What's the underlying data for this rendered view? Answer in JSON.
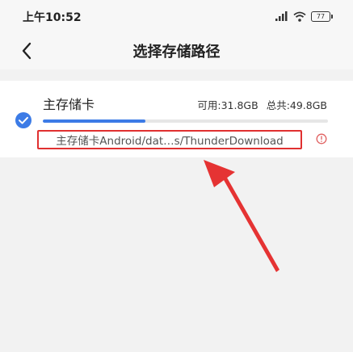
{
  "status_bar": {
    "time": "上午10:52",
    "icons": [
      "signal-icon",
      "wifi-icon",
      "battery-icon"
    ],
    "battery_level": "77"
  },
  "header": {
    "back_icon": "chevron-left-icon",
    "title": "选择存储路径"
  },
  "storage": {
    "name": "主存储卡",
    "available": "可用:31.8GB",
    "total": "总共:49.8GB",
    "used_fraction": 0.36,
    "selected": true,
    "path": "主存储卡Android/dat…s/ThunderDownload",
    "warning_icon": "info-circle-icon"
  },
  "colors": {
    "accent": "#3c7be6",
    "highlight": "#e03030",
    "background": "#f2f2f2"
  }
}
